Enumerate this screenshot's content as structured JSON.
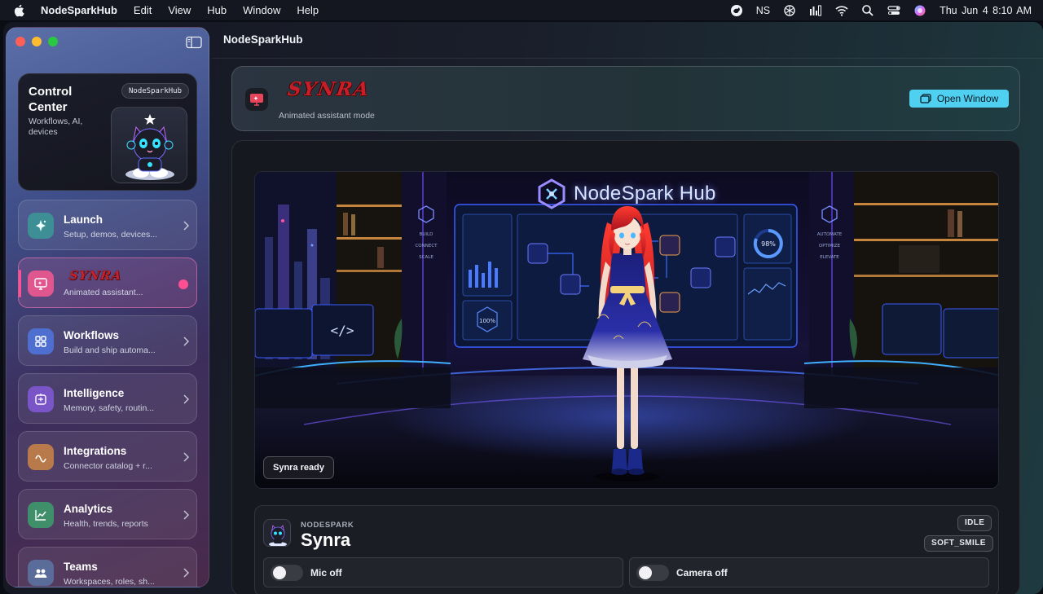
{
  "menubar": {
    "app_name": "NodeSparkHub",
    "menus": [
      "Edit",
      "View",
      "Hub",
      "Window",
      "Help"
    ],
    "status_text": "NS",
    "clock": "Thu Jun 4  8:10 AM"
  },
  "window": {
    "title": "NodeSparkHub"
  },
  "sidebar": {
    "control_center": {
      "title": "Control Center",
      "subtitle": "Workflows, AI, devices",
      "badge": "NodeSparkHub"
    },
    "items": [
      {
        "title": "Launch",
        "subtitle": "Setup, demos, devices...",
        "icon": "sparkle-icon",
        "color": "#3d8f95"
      },
      {
        "title": "",
        "logo_text": "SYNRA",
        "subtitle": "Animated assistant...",
        "icon": "monitor-icon",
        "color": "#e0578f",
        "active": true
      },
      {
        "title": "Workflows",
        "subtitle": "Build and ship automa...",
        "icon": "grid-icon",
        "color": "#4f6fd0"
      },
      {
        "title": "Intelligence",
        "subtitle": "Memory, safety, routin...",
        "icon": "brain-icon",
        "color": "#7a55c8"
      },
      {
        "title": "Integrations",
        "subtitle": "Connector catalog + r...",
        "icon": "connector-icon",
        "color": "#b87a4a"
      },
      {
        "title": "Analytics",
        "subtitle": "Health, trends, reports",
        "icon": "chart-icon",
        "color": "#3f8f6a"
      },
      {
        "title": "Teams",
        "subtitle": "Workspaces, roles, sh...",
        "icon": "people-icon",
        "color": "#5a6c9a"
      }
    ]
  },
  "header": {
    "logo_text": "SYNRA",
    "subtitle": "Animated assistant mode",
    "open_window_label": "Open Window"
  },
  "stage": {
    "brand_text": "NodeSpark Hub",
    "left_wall_labels": [
      "BUILD",
      "CONNECT",
      "SCALE"
    ],
    "right_wall_labels": [
      "AUTOMATE",
      "OPTIMIZE",
      "ELEVATE"
    ],
    "screen_percent_left": "100%",
    "screen_percent_right": "98%",
    "status_chip": "Synra ready"
  },
  "character": {
    "org": "NODESPARK",
    "name": "Synra",
    "state_badge": "IDLE",
    "expression_badge": "SOFT_SMILE",
    "mic_label": "Mic off",
    "camera_label": "Camera off"
  }
}
